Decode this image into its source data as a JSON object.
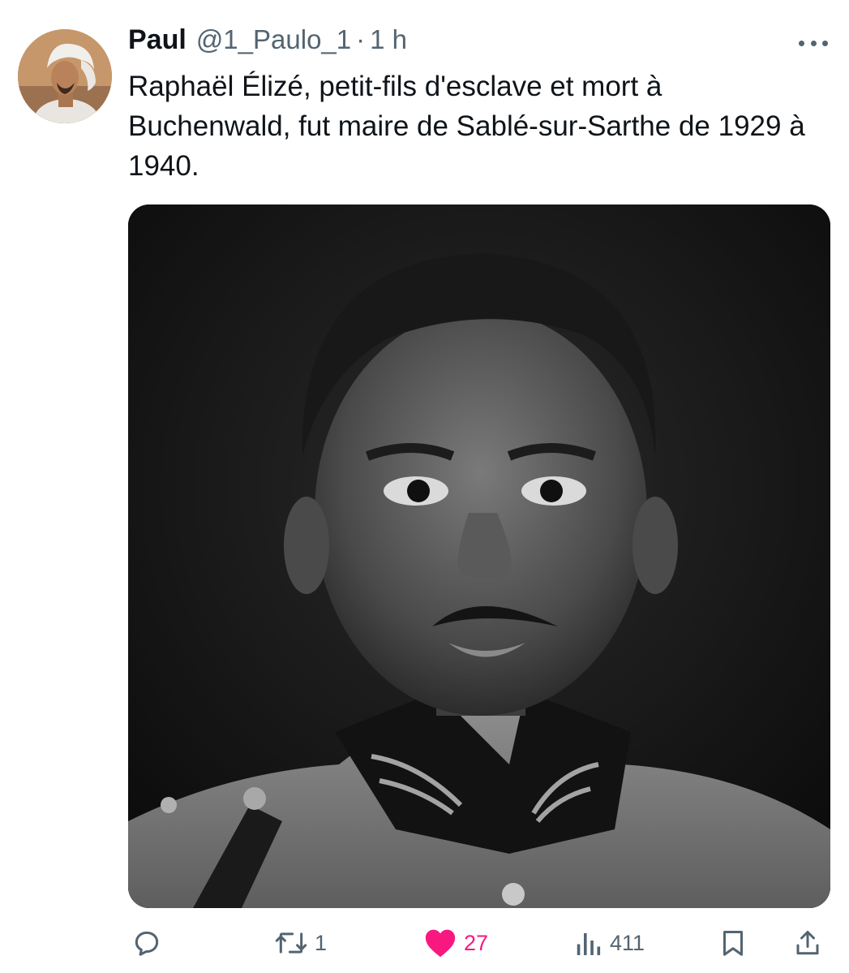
{
  "tweet": {
    "author": {
      "name": "Paul",
      "handle": "@1_Paulo_1",
      "separator": "·",
      "time": "1 h"
    },
    "text": "Raphaël Élizé, petit-fils d'esclave et mort à Buchenwald, fut maire de Sablé-sur-Sarthe de 1929 à 1940.",
    "media": {
      "type": "black-and-white portrait photograph"
    },
    "actions": {
      "reply": {
        "icon": "reply-icon",
        "count": ""
      },
      "retweet": {
        "icon": "retweet-icon",
        "count": "1"
      },
      "like": {
        "icon": "heart-icon",
        "count": "27",
        "liked": true,
        "color": "#f91880"
      },
      "views": {
        "icon": "views-icon",
        "count": "411"
      },
      "bookmark": {
        "icon": "bookmark-icon"
      },
      "share": {
        "icon": "share-icon"
      }
    }
  },
  "colors": {
    "text": "#0f1419",
    "secondary": "#536471",
    "like": "#f91880",
    "background": "#ffffff"
  }
}
